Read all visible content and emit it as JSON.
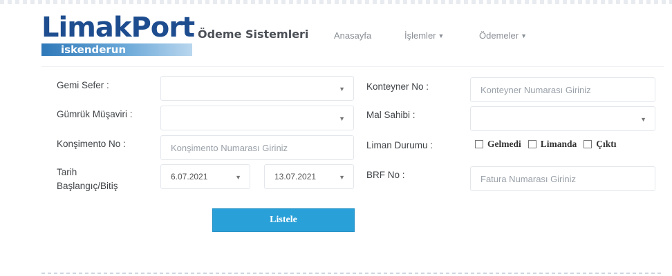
{
  "header": {
    "logo_text": "LimakPort",
    "logo_sub": "iskenderun",
    "brand": "Ödeme Sistemleri",
    "nav": {
      "home": "Anasayfa",
      "islemler": "İşlemler",
      "odemeler": "Ödemeler"
    }
  },
  "form": {
    "gemi_sefer": {
      "label": "Gemi Sefer :",
      "value": ""
    },
    "gumruk": {
      "label": "Gümrük Müşaviri :",
      "value": ""
    },
    "konsimento": {
      "label": "Konşimento No :",
      "placeholder": "Konşimento Numarası Giriniz"
    },
    "tarih": {
      "label_line1": "Tarih",
      "label_line2": "Başlangıç/Bitiş",
      "start": "6.07.2021",
      "end": "13.07.2021"
    },
    "konteyner": {
      "label": "Konteyner No :",
      "placeholder": "Konteyner Numarası Giriniz"
    },
    "mal_sahibi": {
      "label": "Mal Sahibi :",
      "value": ""
    },
    "liman_durumu": {
      "label": "Liman Durumu :",
      "options": [
        "Gelmedi",
        "Limanda",
        "Çıktı"
      ]
    },
    "brf": {
      "label": "BRF No :",
      "placeholder": "Fatura Numarası Giriniz"
    },
    "submit_label": "Listele"
  },
  "icons": {
    "dropdown": "caret-down-icon",
    "checkbox": "checkbox-icon"
  }
}
